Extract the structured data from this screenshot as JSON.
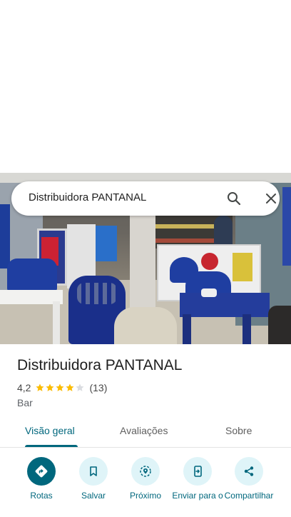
{
  "search": {
    "query": "Distribuidora PANTANAL"
  },
  "place": {
    "name": "Distribuidora PANTANAL",
    "rating": "4,2",
    "review_count": "(13)",
    "stars_filled": 4,
    "stars_total": 5,
    "category": "Bar"
  },
  "tabs": [
    {
      "label": "Visão geral",
      "active": true
    },
    {
      "label": "Avaliações",
      "active": false
    },
    {
      "label": "Sobre",
      "active": false
    }
  ],
  "actions": [
    {
      "label": "Rotas",
      "icon": "directions-icon"
    },
    {
      "label": "Salvar",
      "icon": "bookmark-icon"
    },
    {
      "label": "Próximo",
      "icon": "nearby-icon"
    },
    {
      "label": "Enviar para o",
      "icon": "send-to-phone-icon"
    },
    {
      "label": "Compartilhar",
      "icon": "share-icon"
    }
  ],
  "colors": {
    "accent": "#00677d",
    "action_bg": "#dff4f8",
    "star": "#fbbc04",
    "star_empty": "#dadce0"
  }
}
